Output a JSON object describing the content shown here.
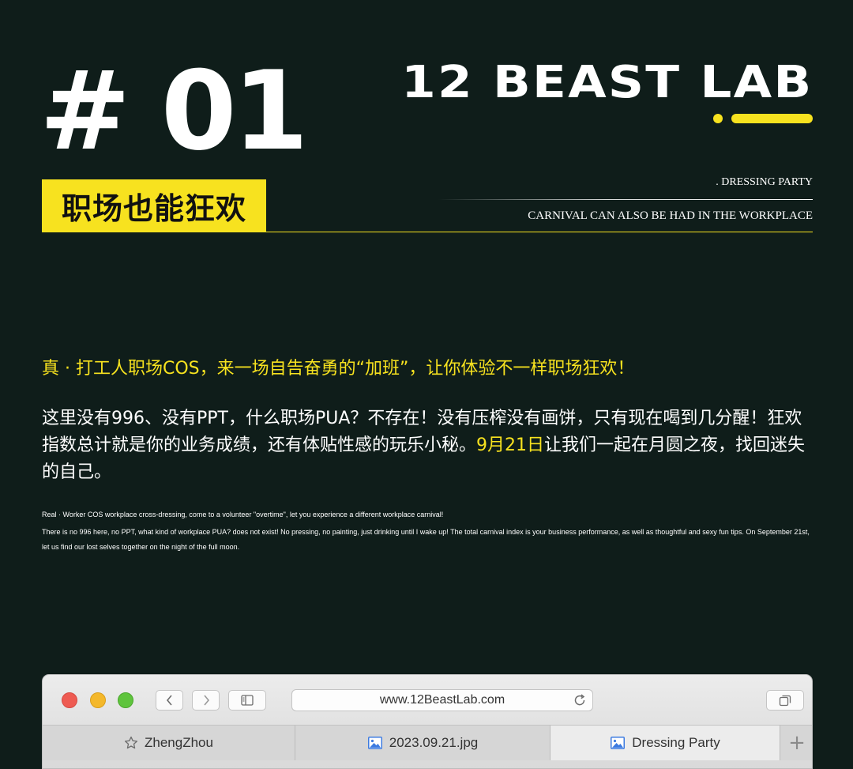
{
  "header": {
    "number": "# 01",
    "title_cn": "职场也能狂欢",
    "brand": "12 BEAST LAB",
    "sub_label": ". DRESSING PARTY",
    "sub_caption": "CARNIVAL CAN ALSO BE HAD IN THE WORKPLACE"
  },
  "content": {
    "cn_lead": "真 · 打工人职场COS，来一场自告奋勇的“加班”，让你体验不一样职场狂欢！",
    "cn_body_a": "这里没有996、没有PPT，什么职场PUA？不存在！没有压榨没有画饼，只有现在喝到几分醒！狂欢指数总计就是你的业务成绩，还有体贴性感的玩乐小秘。",
    "cn_body_date": "9月21日",
    "cn_body_b": "让我们一起在月圆之夜，找回迷失的自己。",
    "en_lead": "Real  ·  Worker COS workplace cross-dressing, come to a volunteer \"overtime\", let you experience a different workplace carnival!",
    "en_body": "There is no 996 here, no PPT, what kind of workplace PUA? does not exist! No pressing, no painting, just drinking until I wake up! The total carnival index is your business performance, as well as thoughtful and sexy fun tips. On September 21st, let us find our lost selves together on the night of the full moon."
  },
  "browser": {
    "url": "www.12BeastLab.com",
    "tabs": [
      {
        "label": "ZhengZhou",
        "icon": "star-icon"
      },
      {
        "label": "2023.09.21.jpg",
        "icon": "image-icon"
      },
      {
        "label": "Dressing Party",
        "icon": "image-icon"
      }
    ],
    "add_tab_label": "+"
  },
  "colors": {
    "background": "#0f1d1a",
    "accent": "#f7e21f",
    "text": "#ffffff"
  }
}
